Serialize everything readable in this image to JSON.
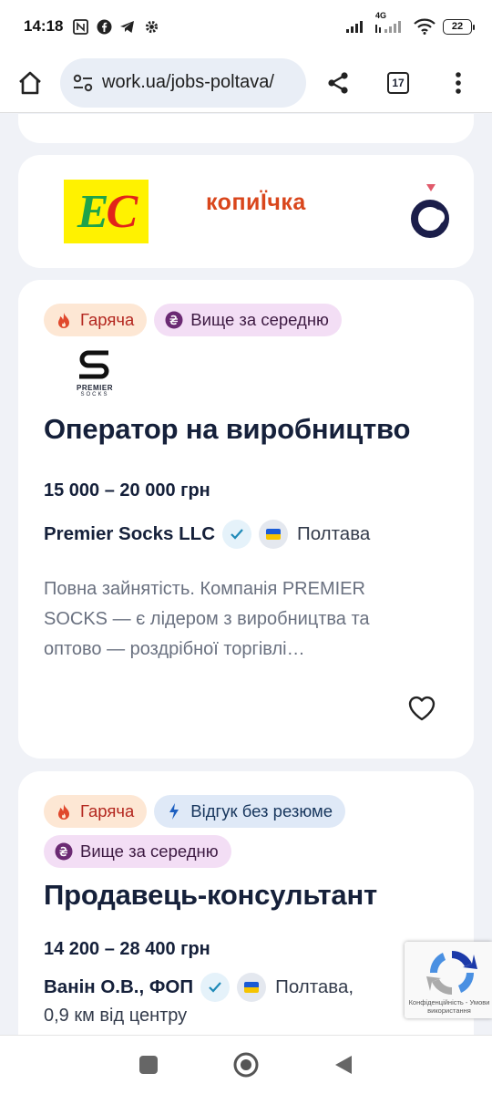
{
  "status_bar": {
    "time": "14:18",
    "icons_left": [
      "nfc-icon",
      "facebook-icon",
      "telegram-icon",
      "settings-icon"
    ],
    "network": "4G",
    "battery": "22"
  },
  "browser": {
    "url": "work.ua/jobs-poltava/",
    "tab_count": "17"
  },
  "logos_carousel": {
    "logos": [
      {
        "name": "EC",
        "e": "E",
        "c": "C"
      },
      {
        "name": "копиЇчка",
        "text": "копиЇчка"
      }
    ]
  },
  "jobs": [
    {
      "tags": [
        {
          "label": "Гаряча",
          "icon": "fire-icon"
        },
        {
          "label": "Вище за середню",
          "icon": "hryvnia-icon"
        }
      ],
      "company_logo": {
        "line1": "PREMIER",
        "line2": "SOCKS"
      },
      "title": "Оператор на виробництво",
      "salary": "15 000 – 20 000 грн",
      "company": "Premier Socks LLC",
      "city": "Полтава",
      "description": "Повна зайнятість. Компанія PREMIER SOCKS — є лідером з виробництва та оптово — роздрібної торгівлі…"
    },
    {
      "tags": [
        {
          "label": "Гаряча",
          "icon": "fire-icon"
        },
        {
          "label": "Відгук без резюме",
          "icon": "lightning-icon"
        },
        {
          "label": "Вище за середню",
          "icon": "hryvnia-icon"
        }
      ],
      "title": "Продавець-консультант",
      "salary": "14 200 – 28 400 грн",
      "company": "Ванін О.В., ФОП",
      "city": "Полтава,",
      "distance": "0,9 км від центру"
    }
  ],
  "recaptcha": {
    "text": "Конфіденційність - Умови використання"
  },
  "colors": {
    "background": "#f0f2f7",
    "hot_tag": "#fde7d4",
    "above_tag": "#f3def5",
    "fast_tag": "#dfe9f7",
    "title": "#15203a"
  }
}
